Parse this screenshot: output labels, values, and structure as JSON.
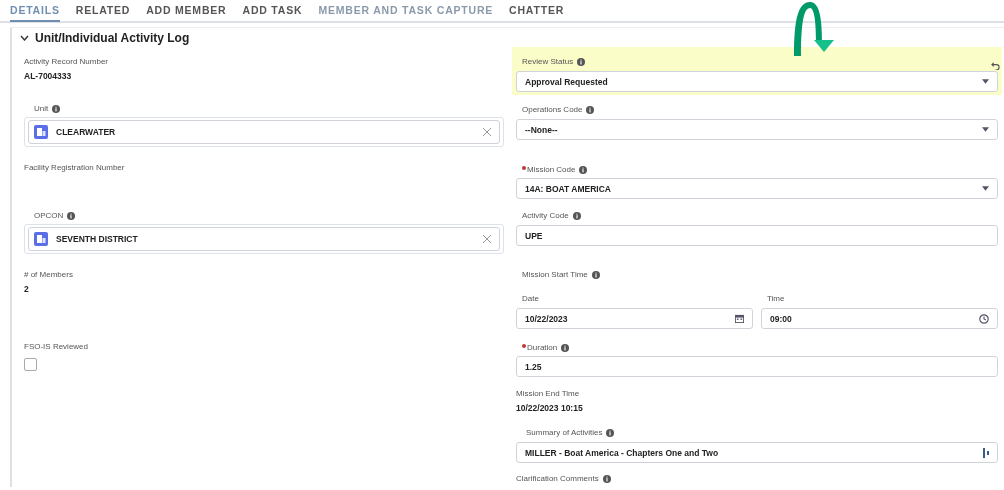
{
  "tabs": [
    {
      "label": "DETAILS",
      "selected": true
    },
    {
      "label": "RELATED",
      "selected": false
    },
    {
      "label": "ADD MEMBER",
      "selected": false
    },
    {
      "label": "ADD TASK",
      "selected": false
    },
    {
      "label": "MEMBER AND TASK CAPTURE",
      "selected": false
    },
    {
      "label": "CHATTER",
      "selected": false
    }
  ],
  "section": {
    "title": "Unit/Individual Activity Log",
    "expanded": true
  },
  "rows": [
    {
      "left": {
        "kind": "readonly",
        "label": "Activity Record Number",
        "value": "AL-7004333"
      },
      "right": {
        "kind": "select",
        "label": "Review Status",
        "info": true,
        "value": "Approval Requested",
        "edited": true
      }
    },
    {
      "left": {
        "kind": "lookup",
        "label": "Unit",
        "info": true,
        "value": "CLEARWATER"
      },
      "right": {
        "kind": "select",
        "label": "Operations Code",
        "info": true,
        "value": "--None--"
      }
    },
    {
      "left": {
        "kind": "readonly",
        "label": "Facility Registration Number"
      },
      "right": {
        "kind": "select",
        "label": "Mission Code",
        "info": true,
        "required": true,
        "value": "14A: BOAT AMERICA"
      }
    },
    {
      "left": {
        "kind": "lookup",
        "label": "OPCON",
        "info": true,
        "value": "SEVENTH DISTRICT"
      },
      "right": {
        "kind": "input",
        "label": "Activity Code",
        "info": true,
        "value": "UPE"
      }
    },
    {
      "left": {
        "kind": "readonly",
        "label": "# of Members",
        "value": "2"
      },
      "right": {
        "kind": "datetime",
        "label": "Mission Start Time",
        "info": true,
        "date_label": "Date",
        "date": "10/22/2023",
        "time_label": "Time",
        "time": "09:00"
      }
    },
    {
      "left": {
        "kind": "checkbox",
        "label": "FSO-IS Reviewed",
        "checked": false
      },
      "right": {
        "kind": "input",
        "label": "Duration",
        "info": true,
        "required": true,
        "value": "1.25"
      }
    },
    {
      "right": {
        "kind": "readonly",
        "label": "Mission End Time",
        "value": "10/22/2023 10:15"
      }
    },
    {
      "right": {
        "kind": "textarea",
        "label": "Summary of Activities",
        "info": true,
        "value": "MILLER - Boat America - Chapters One and Two"
      }
    },
    {
      "right": {
        "kind": "label",
        "label": "Clarification Comments",
        "info": true
      }
    }
  ]
}
